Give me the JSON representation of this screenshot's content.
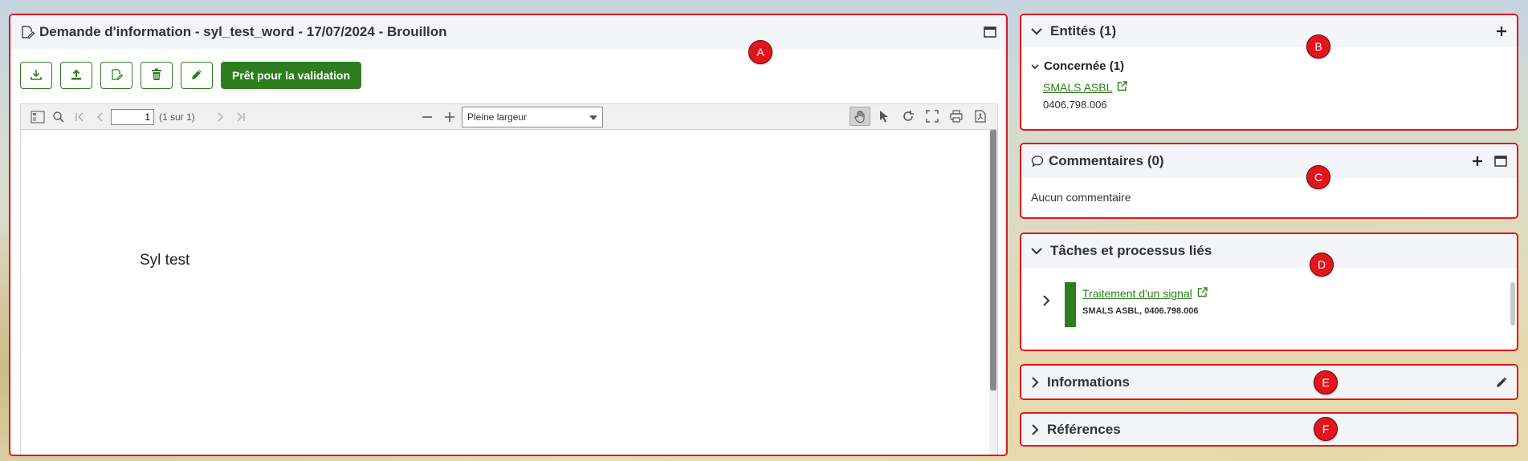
{
  "panel_a": {
    "title": "Demande d'information - syl_test_word - 17/07/2024 - Brouillon",
    "marker": "A",
    "toolbar": {
      "primary_label": "Prêt pour la validation",
      "icons": [
        "download-icon",
        "upload-icon",
        "edit-document-icon",
        "trash-icon",
        "pencil-icon"
      ]
    },
    "viewer": {
      "page_value": "1",
      "page_count": "(1 sur 1)",
      "zoom": "Pleine largeur",
      "doc_text": "Syl test"
    }
  },
  "panel_b": {
    "title": "Entités (1)",
    "marker": "B",
    "group": "Concernée (1)",
    "entity_name": "SMALS ASBL",
    "entity_number": "0406.798.006"
  },
  "panel_c": {
    "title": "Commentaires (0)",
    "marker": "C",
    "empty_text": "Aucun commentaire"
  },
  "panel_d": {
    "title": "Tâches et processus liés",
    "marker": "D",
    "task_name": "Traitement d'un signal",
    "task_sub": "SMALS ASBL, 0406.798.006"
  },
  "panel_e": {
    "title": "Informations",
    "marker": "E"
  },
  "panel_f": {
    "title": "Références",
    "marker": "F"
  },
  "colors": {
    "accent_green": "#2e7d1e",
    "marker_red": "#e0161c"
  }
}
